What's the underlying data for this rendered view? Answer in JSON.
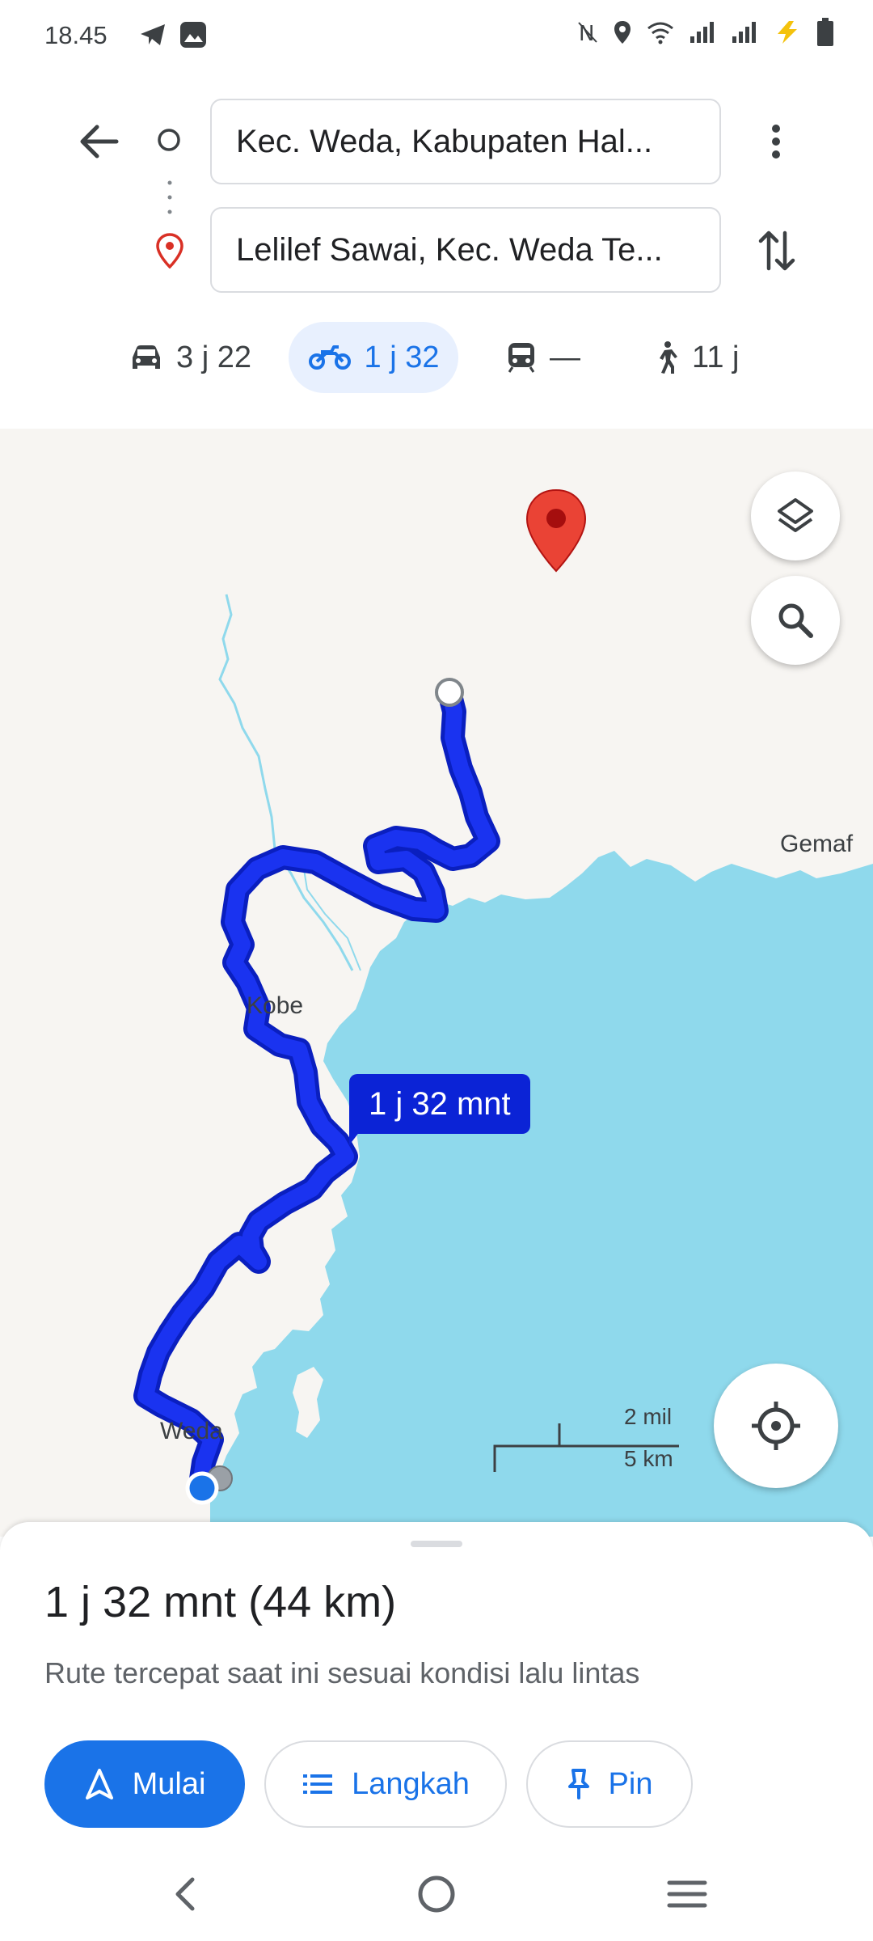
{
  "status_bar": {
    "time": "18.45",
    "icons": [
      "telegram-icon",
      "gallery-icon",
      "nfc-icon",
      "location-icon",
      "wifi-icon",
      "signal-icon",
      "signal-icon",
      "charging-icon",
      "battery-icon"
    ]
  },
  "directions": {
    "origin": "Kec. Weda, Kabupaten Hal...",
    "destination": "Lelilef Sawai, Kec. Weda Te..."
  },
  "modes": [
    {
      "name": "car",
      "label": "3 j 22",
      "icon": "car-icon"
    },
    {
      "name": "motorcycle",
      "label": "1 j 32",
      "icon": "motorcycle-icon",
      "selected": true
    },
    {
      "name": "transit",
      "label": "—",
      "icon": "train-icon"
    },
    {
      "name": "walk",
      "label": "11 j",
      "icon": "walk-icon"
    }
  ],
  "map": {
    "labels": {
      "gemaf": "Gemaf",
      "kobe": "Kobe",
      "weda": "Weda"
    },
    "eta_bubble": "1 j 32 mnt",
    "scale": {
      "imperial": "2 mil",
      "metric": "5 km"
    },
    "colors": {
      "land": "#f7f5f2",
      "water": "#8fd9ec",
      "route": "#1a33f0",
      "pin": "#ea4335"
    }
  },
  "sheet": {
    "summary": "1 j 32 mnt (44 km)",
    "subtitle": "Rute tercepat saat ini sesuai kondisi lalu lintas",
    "start_label": "Mulai",
    "steps_label": "Langkah",
    "pin_label": "Pin"
  }
}
